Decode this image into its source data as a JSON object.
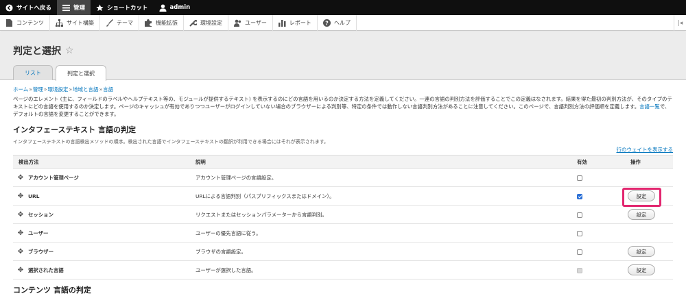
{
  "toolbar": {
    "back_label": "サイトへ戻る",
    "manage_label": "管理",
    "shortcuts_label": "ショートカット",
    "user_label": "admin"
  },
  "tray": {
    "items": [
      {
        "label": "コンテンツ",
        "icon": "file-icon"
      },
      {
        "label": "サイト構築",
        "icon": "structure-icon"
      },
      {
        "label": "テーマ",
        "icon": "paintbrush-icon"
      },
      {
        "label": "機能拡張",
        "icon": "puzzle-icon"
      },
      {
        "label": "環境設定",
        "icon": "wrench-icon"
      },
      {
        "label": "ユーザー",
        "icon": "people-icon"
      },
      {
        "label": "レポート",
        "icon": "bar-chart-icon"
      },
      {
        "label": "ヘルプ",
        "icon": "help-icon"
      }
    ]
  },
  "header": {
    "title": "判定と選択",
    "tabs": [
      "リスト",
      "判定と選択"
    ]
  },
  "breadcrumb": [
    "ホーム",
    "管理",
    "環境設定",
    "地域と言語",
    "言語"
  ],
  "description": {
    "text_before_link": "ページのエレメント (主に、フィールドのラベルやヘルプテキスト等の、モジュールが提供するテキスト) を表示するのにどの言語を用いるのか決定する方法を定義してください。一連の言語の判別方法を評価することでこの定義はなされます。結果を得た最初の判別方法が、そのタイプのテキストにどの言語を使用するのか決定します。ページのキャッシュが有効でありつつユーザーがログインしていない場合のブラウザーによる判別等、特定の条件では動作しない言語判別方法があることに注意してください。このページで、言語判別方法の評価順を定義します。",
    "link_text": "言語一覧",
    "text_after_link": "で、デフォルトの言語を変更することができます。"
  },
  "section1": {
    "title": "インタフェーステキスト 言語の判定",
    "subtitle": "インタフェーステキストの言語検出メソッドの順序。検出された言語でインタフェーステキストの翻訳が利用できる場合にはそれが表示されます。",
    "weight_link": "行のウェイトを表示する"
  },
  "table": {
    "headers": [
      "検出方法",
      "説明",
      "有効",
      "操作"
    ],
    "rows": [
      {
        "name": "アカウント管理ページ",
        "desc": "アカウント管理ページの言語設定。",
        "enabled": false,
        "disabled": false,
        "op": ""
      },
      {
        "name": "URL",
        "desc": "URLによる言語判別（パスプリフィックスまたはドメイン）。",
        "enabled": true,
        "disabled": false,
        "op": "設定"
      },
      {
        "name": "セッション",
        "desc": "リクエストまたはセッションパラメーターから言語判別。",
        "enabled": false,
        "disabled": false,
        "op": "設定"
      },
      {
        "name": "ユーザー",
        "desc": "ユーザーの優先言語に従う。",
        "enabled": false,
        "disabled": false,
        "op": ""
      },
      {
        "name": "ブラウザー",
        "desc": "ブラウザの言語設定。",
        "enabled": false,
        "disabled": false,
        "op": "設定"
      },
      {
        "name": "選択された言語",
        "desc": "ユーザーが選択した言語。",
        "enabled": true,
        "disabled": true,
        "op": "設定"
      }
    ]
  },
  "section2": {
    "title": "コンテンツ 言語の判定"
  },
  "colors": {
    "highlight": "#e2266f",
    "link": "#0074bd",
    "toolbar_bg": "#0f0f0f"
  }
}
